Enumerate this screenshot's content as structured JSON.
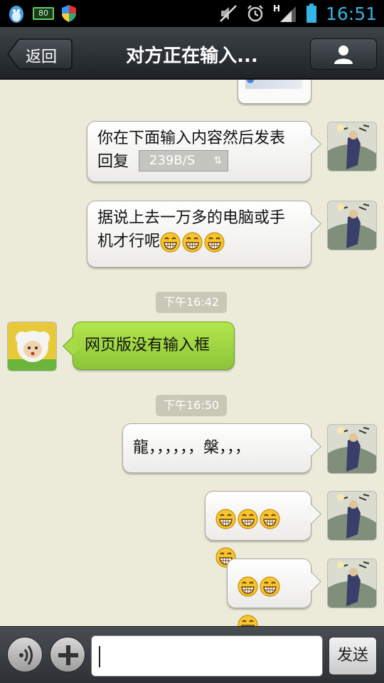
{
  "status_bar": {
    "battery_badge": "80",
    "clock": "16:51",
    "network": "H",
    "icons": [
      "qq-penguin-icon",
      "battery-80-icon",
      "shield-icon",
      "mute-icon",
      "alarm-icon",
      "signal-icon",
      "battery-icon"
    ]
  },
  "header": {
    "back_label": "返回",
    "title": "对方正在输入...",
    "profile_icon": "user-icon"
  },
  "messages": [
    {
      "side": "right",
      "text": "你在下面输入内容然后发表回复",
      "line1": "你在下面输入内容然后发表",
      "line2": "回复",
      "badge": "239B/S",
      "badge_icon": "transfer-arrows-icon"
    },
    {
      "side": "right",
      "text": "据说上去一万多的电脑或手机才行呢",
      "line1": "据说上去一万多的电脑或手",
      "line2": "机才行呢",
      "emoji": [
        "grin",
        "grin",
        "grin"
      ]
    },
    {
      "timestamp": "下午16:42"
    },
    {
      "side": "left",
      "text": "网页版没有输入框"
    },
    {
      "timestamp": "下午16:50"
    },
    {
      "side": "right",
      "text": "龍，，，，，，槃，，，"
    },
    {
      "side": "right",
      "text": "",
      "emoji": [
        "grin",
        "grin",
        "grin",
        "grin"
      ]
    },
    {
      "side": "right",
      "text": "",
      "emoji": [
        "grin",
        "grin",
        "grin"
      ]
    }
  ],
  "composer": {
    "voice_icon": "voice-icon",
    "plus_icon": "plus-icon",
    "input_value": "",
    "send_label": "发送"
  },
  "colors": {
    "chat_bg": "#ecebd9",
    "clock": "#33b5e5",
    "green_bubble": "#a6db45"
  }
}
